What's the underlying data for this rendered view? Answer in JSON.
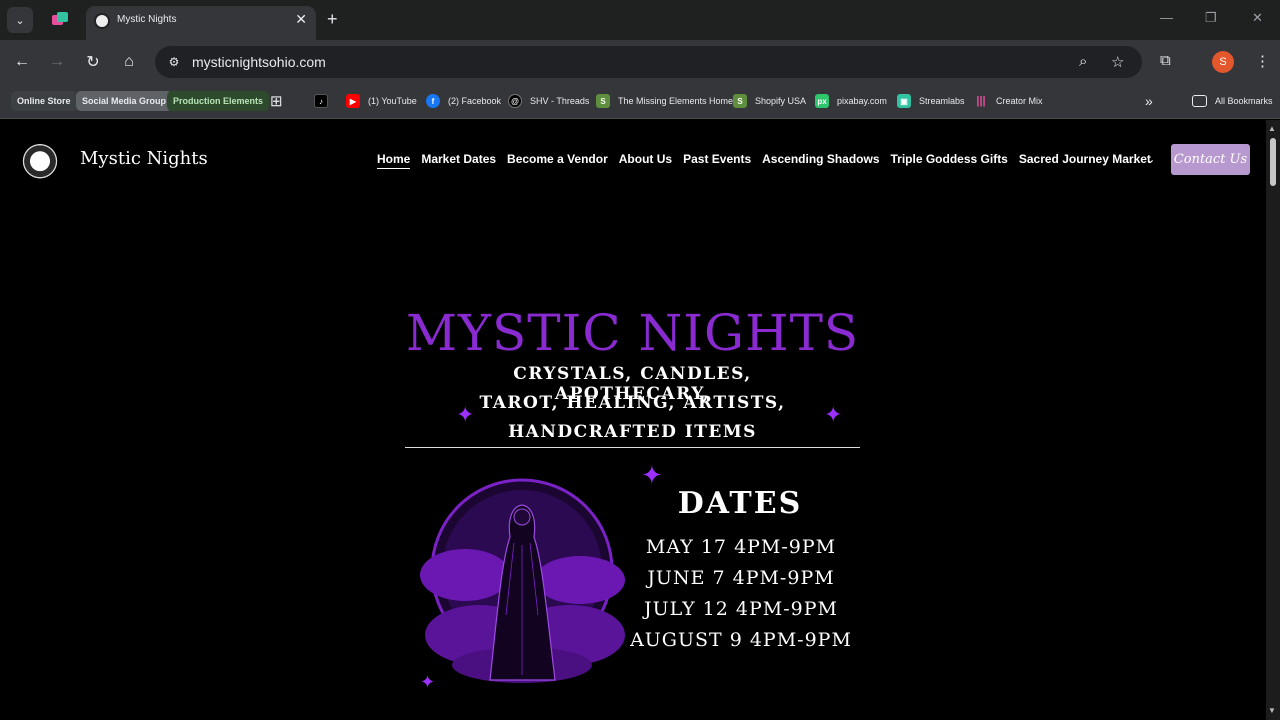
{
  "browser": {
    "tab_title": "Mystic Nights",
    "url": "mysticnightsohio.com",
    "profile_initial": "S"
  },
  "bookmarks": {
    "items": [
      {
        "label": "Online Store",
        "style": "pill",
        "color": "#3c4043"
      },
      {
        "label": "Social Media Group",
        "style": "pill",
        "color": "#5f6368"
      },
      {
        "label": "Production Elements",
        "style": "pill",
        "color": "#2d4a2d"
      },
      {
        "label": "(1) YouTube",
        "icon": "youtube-icon",
        "color": "#ff0000"
      },
      {
        "label": "(2) Facebook",
        "icon": "facebook-icon",
        "color": "#1877f2"
      },
      {
        "label": "SHV - Threads",
        "icon": "threads-icon",
        "color": "#000000"
      },
      {
        "label": "The Missing Elements Home",
        "icon": "shopify-icon",
        "color": "#5e8e3e"
      },
      {
        "label": "Shopify USA",
        "icon": "shopify-icon",
        "color": "#5e8e3e"
      },
      {
        "label": "pixabay.com",
        "icon": "pixabay-icon",
        "color": "#2ec66d"
      },
      {
        "label": "Streamlabs",
        "icon": "streamlabs-icon",
        "color": "#31c3a2"
      },
      {
        "label": "Creator Mix",
        "icon": "creator-mix-icon",
        "color": "#e94d9b"
      }
    ],
    "all_bookmarks": "All Bookmarks"
  },
  "site": {
    "title": "Mystic Nights",
    "nav": [
      {
        "label": "Home",
        "active": true
      },
      {
        "label": "Market Dates"
      },
      {
        "label": "Become a Vendor"
      },
      {
        "label": "About Us"
      },
      {
        "label": "Past Events"
      },
      {
        "label": "Ascending Shadows"
      },
      {
        "label": "Triple Goddess Gifts"
      },
      {
        "label": "Sacred Journey Market"
      }
    ],
    "nav_more": "...",
    "contact_label": "Contact Us",
    "contact_color": "#b799cf"
  },
  "poster": {
    "title": "MYSTIC NIGHTS",
    "title_color": "#8a2bd1",
    "lines": [
      "CRYSTALS, CANDLES, APOTHECARY,",
      "TAROT, HEALING, ARTISTS,",
      "HANDCRAFTED ITEMS"
    ],
    "dates_heading": "DATES",
    "dates": [
      "MAY 17 4PM-9PM",
      "JUNE 7 4PM-9PM",
      "JULY 12 4PM-9PM",
      "AUGUST 9 4PM-9PM"
    ]
  }
}
